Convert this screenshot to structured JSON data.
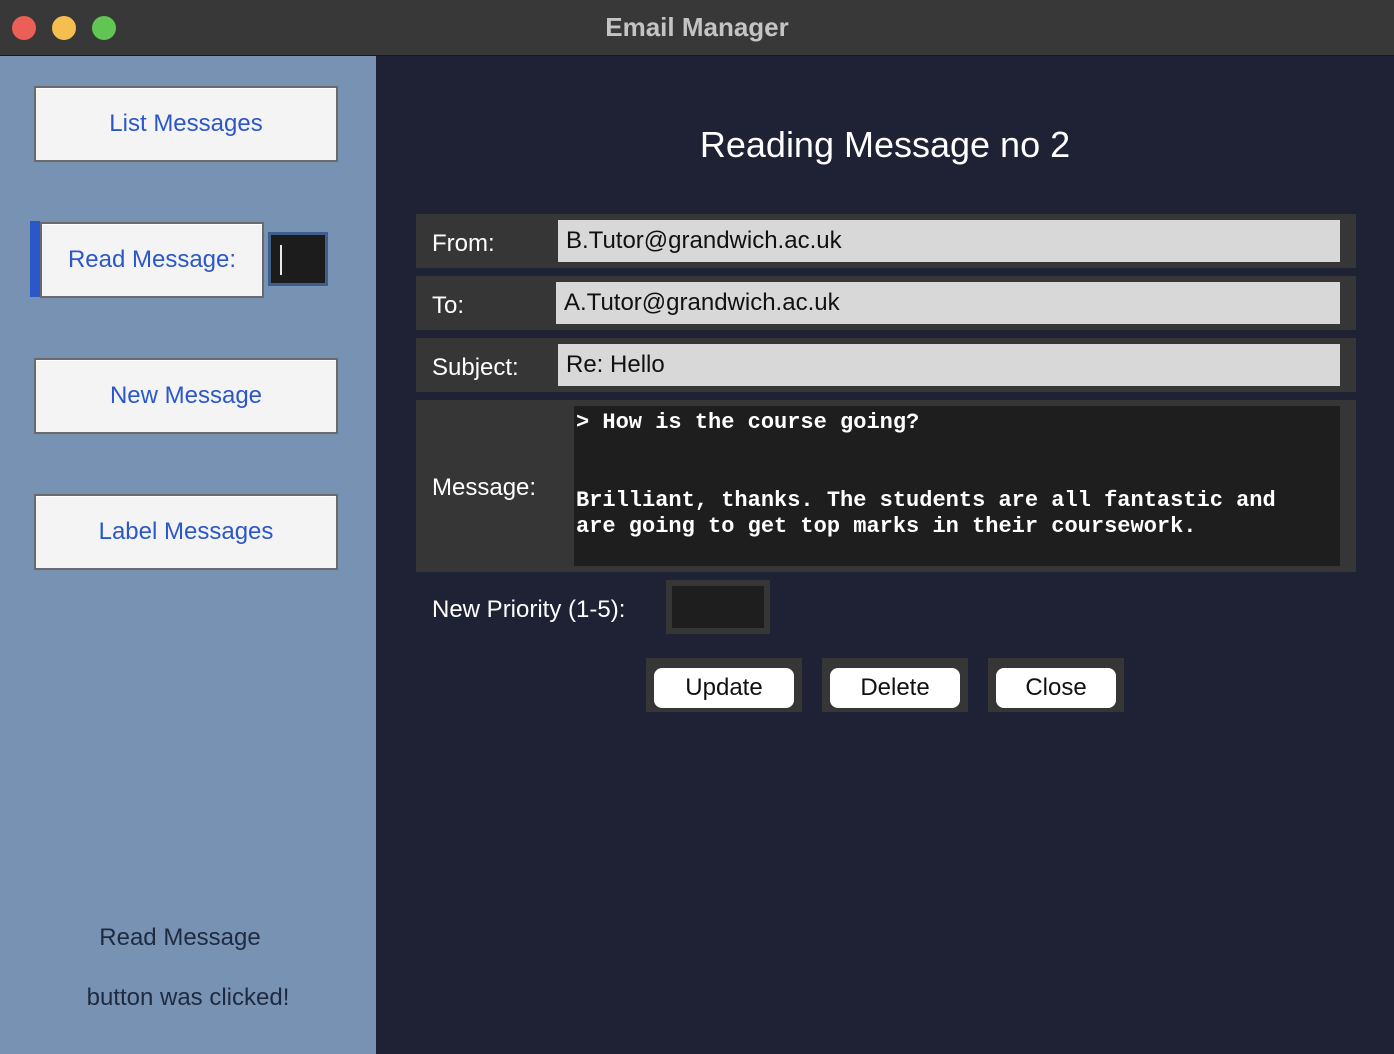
{
  "window": {
    "title": "Email Manager"
  },
  "sidebar": {
    "list_label": "List Messages",
    "read_label": "Read Message:",
    "read_input_value": "",
    "new_label": "New Message",
    "label_label": "Label Messages",
    "status_line1": "Read Message",
    "status_line2": "button was clicked!"
  },
  "main": {
    "heading": "Reading Message no 2",
    "from_label": "From:",
    "from_value": "B.Tutor@grandwich.ac.uk",
    "to_label": "To:",
    "to_value": "A.Tutor@grandwich.ac.uk",
    "subject_label": "Subject:",
    "subject_value": "Re: Hello",
    "message_label": "Message:",
    "message_lines": [
      "> How is the course going?",
      "Brilliant, thanks. The students are all fantastic and",
      "are going to get top marks in their coursework."
    ],
    "priority_label": "New Priority (1-5):",
    "priority_value": "",
    "update_label": "Update",
    "delete_label": "Delete",
    "close_label": "Close"
  },
  "colors": {
    "sidebar_bg": "#7792b3",
    "main_bg": "#1f2135",
    "button_text": "#2b57c9",
    "active_indicator": "#2b57c9"
  }
}
